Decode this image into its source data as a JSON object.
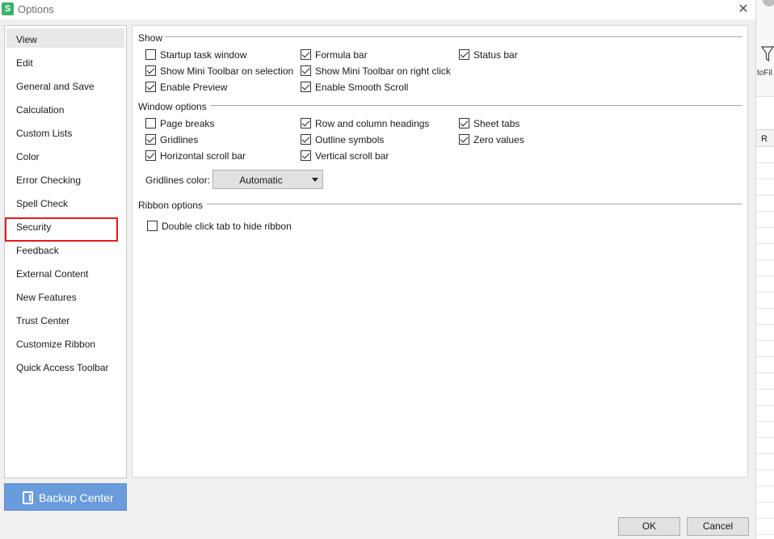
{
  "window": {
    "title": "Options",
    "app_icon_letter": "S",
    "close_glyph": "✕"
  },
  "nav": {
    "selected": "View",
    "highlighted": "Security",
    "items": [
      {
        "label": "View"
      },
      {
        "label": "Edit"
      },
      {
        "label": "General and Save"
      },
      {
        "label": "Calculation"
      },
      {
        "label": "Custom Lists"
      },
      {
        "label": "Color"
      },
      {
        "label": "Error Checking"
      },
      {
        "label": "Spell Check"
      },
      {
        "label": "Security"
      },
      {
        "label": "Feedback"
      },
      {
        "label": "External Content"
      },
      {
        "label": "New Features"
      },
      {
        "label": "Trust Center"
      },
      {
        "label": "Customize Ribbon"
      },
      {
        "label": "Quick Access Toolbar"
      }
    ]
  },
  "backup": {
    "label": "Backup Center",
    "icon": "backup-icon"
  },
  "show": {
    "title": "Show",
    "options": [
      {
        "label": "Startup task window",
        "checked": false
      },
      {
        "label": "Formula bar",
        "checked": true
      },
      {
        "label": "Status bar",
        "checked": true
      },
      {
        "label": "Show Mini Toolbar on selection",
        "checked": true
      },
      {
        "label": "Show Mini Toolbar on right click",
        "checked": true
      },
      {
        "label": "Enable Preview",
        "checked": true
      },
      {
        "label": "Enable Smooth Scroll",
        "checked": true
      }
    ]
  },
  "window_options": {
    "title": "Window options",
    "options": [
      {
        "label": "Page breaks",
        "checked": false
      },
      {
        "label": "Row and column headings",
        "checked": true
      },
      {
        "label": "Sheet tabs",
        "checked": true
      },
      {
        "label": "Gridlines",
        "checked": true
      },
      {
        "label": "Outline symbols",
        "checked": true
      },
      {
        "label": "Zero values",
        "checked": true
      },
      {
        "label": "Horizontal scroll bar",
        "checked": true
      },
      {
        "label": "Vertical scroll bar",
        "checked": true
      }
    ],
    "gridlines_color": {
      "label": "Gridlines color:",
      "value": "Automatic"
    }
  },
  "ribbon_options": {
    "title": "Ribbon options",
    "options": [
      {
        "label": "Double click tab to hide ribbon",
        "checked": false
      }
    ]
  },
  "buttons": {
    "ok": "OK",
    "cancel": "Cancel"
  },
  "background": {
    "filter_label": "toFil",
    "column_header": "R"
  },
  "colors": {
    "accent": "#6a9cdb",
    "highlight": "#e21b1b",
    "app_icon": "#3bb36a"
  }
}
